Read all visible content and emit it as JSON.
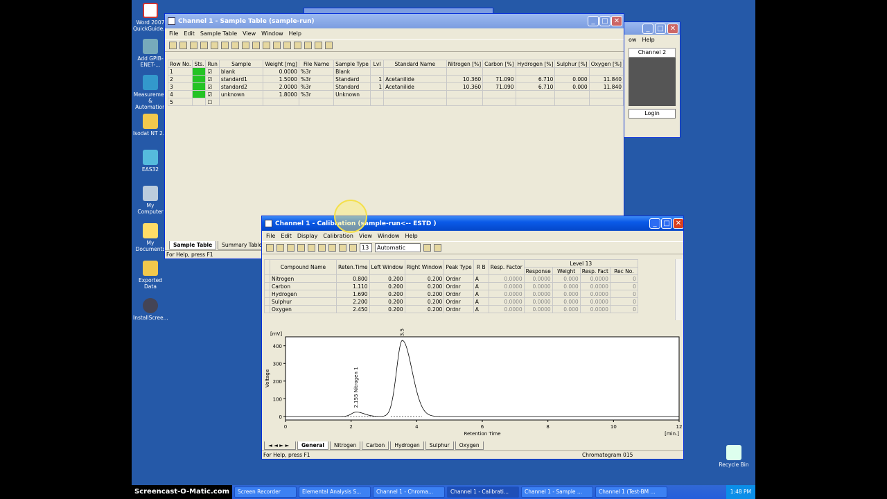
{
  "desktop": {
    "icons": [
      "Word 2007 QuickGuide...",
      "Add GPIB-ENET-...",
      "Measuremen & Automation",
      "Isodat NT 2.0",
      "EAS32",
      "My Computer",
      "My Documents",
      "Exported Data",
      "InstallScree..."
    ],
    "recycle": "Recycle Bin"
  },
  "back_window": {
    "menu": [
      "ow",
      "Help"
    ],
    "label": "Channel 2",
    "login": "Login"
  },
  "sample_window": {
    "title": "Channel 1 - Sample Table (sample-run)",
    "menu": [
      "File",
      "Edit",
      "Sample Table",
      "View",
      "Window",
      "Help"
    ],
    "headers": [
      "Row No.",
      "Sts.",
      "Run",
      "Sample",
      "Weight [mg]",
      "File Name",
      "Sample Type",
      "Lvl",
      "Standard Name",
      "Nitrogen [%]",
      "Carbon [%]",
      "Hydrogen [%]",
      "Sulphur [%]",
      "Oxygen [%]"
    ],
    "rows": [
      [
        "1",
        "",
        "☑",
        "blank",
        "0.0000",
        "%3r",
        "Blank",
        "",
        "",
        "",
        "",
        "",
        "",
        ""
      ],
      [
        "2",
        "",
        "☑",
        "standard1",
        "1.5000",
        "%3r",
        "Standard",
        "1",
        "Acetanilide",
        "10.360",
        "71.090",
        "6.710",
        "0.000",
        "11.840"
      ],
      [
        "3",
        "",
        "☑",
        "standard2",
        "2.0000",
        "%3r",
        "Standard",
        "1",
        "Acetanilide",
        "10.360",
        "71.090",
        "6.710",
        "0.000",
        "11.840"
      ],
      [
        "4",
        "",
        "☑",
        "unknown",
        "1.8000",
        "%3r",
        "Unknown",
        "",
        "",
        "",
        "",
        "",
        "",
        ""
      ],
      [
        "5",
        "",
        "☐",
        "",
        "",
        "",
        "",
        "",
        "",
        "",
        "",
        "",
        "",
        ""
      ]
    ],
    "tabs": [
      "Sample Table",
      "Summary Table"
    ],
    "status": "For Help, press F1"
  },
  "calib_window": {
    "title": "Channel 1 - Calibration (sample-run<-- ESTD  )",
    "menu": [
      "File",
      "Edit",
      "Display",
      "Calibration",
      "View",
      "Window",
      "Help"
    ],
    "level_value": "13",
    "mode": "Automatic",
    "headers": [
      "",
      "Compound Name",
      "Reten.Time",
      "Left Window",
      "Right Window",
      "Peak Type",
      "R B",
      "Resp. Factor"
    ],
    "level_header": "Level 13",
    "level_sub": [
      "Response",
      "Weight",
      "Resp. Fact",
      "Rec No."
    ],
    "rows": [
      [
        "Nitrogen",
        "0.800",
        "0.200",
        "0.200",
        "Ordnr",
        "A",
        "0.0000",
        "0.0000",
        "0.000",
        "0.0000",
        "0"
      ],
      [
        "Carbon",
        "1.110",
        "0.200",
        "0.200",
        "Ordnr",
        "A",
        "0.0000",
        "0.0000",
        "0.000",
        "0.0000",
        "0"
      ],
      [
        "Hydrogen",
        "1.690",
        "0.200",
        "0.200",
        "Ordnr",
        "A",
        "0.0000",
        "0.0000",
        "0.000",
        "0.0000",
        "0"
      ],
      [
        "Sulphur",
        "2.200",
        "0.200",
        "0.200",
        "Ordnr",
        "A",
        "0.0000",
        "0.0000",
        "0.000",
        "0.0000",
        "0"
      ],
      [
        "Oxygen",
        "2.450",
        "0.200",
        "0.200",
        "Ordnr",
        "A",
        "0.0000",
        "0.0000",
        "0.000",
        "0.0000",
        "0"
      ]
    ],
    "tabs": [
      "General",
      "Nitrogen",
      "Carbon",
      "Hydrogen",
      "Sulphur",
      "Oxygen"
    ],
    "status": "For Help, press F1",
    "chromatogram": "Chromatogram  015"
  },
  "chart_data": {
    "type": "line",
    "ylabel": "Voltage",
    "yunit": "[mV]",
    "xlabel": "Retention Time",
    "xunit": "[min.]",
    "xlim": [
      0,
      12
    ],
    "ylim": [
      -20,
      450
    ],
    "xticks": [
      0,
      2,
      4,
      6,
      8,
      10,
      12
    ],
    "yticks": [
      0,
      100,
      200,
      300,
      400
    ],
    "peaks": [
      {
        "label": "2.155 Nitrogen 1",
        "x": 2.155,
        "y": 25
      },
      {
        "label": "3.560 Carbon 2",
        "x": 3.56,
        "y": 430
      }
    ]
  },
  "taskbar": {
    "watermark": "Screencast-O-Matic.com",
    "items": [
      "Screen Recorder",
      "Elemental Analysis S...",
      "Channel 1 - Chroma...",
      "Channel 1 - Calibrati...",
      "Channel 1 - Sample ...",
      "Channel 1 (Test-BM ..."
    ],
    "clock": "1:48 PM"
  }
}
